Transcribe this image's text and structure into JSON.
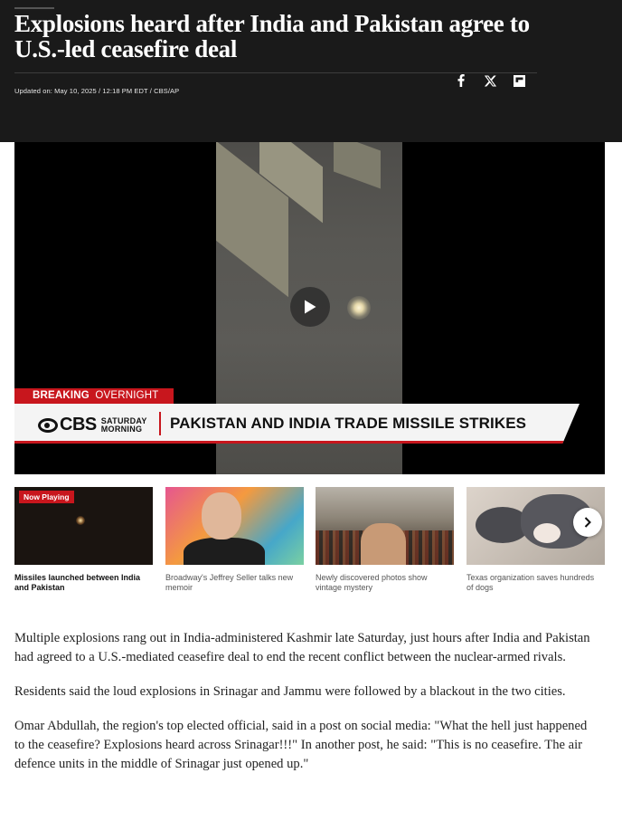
{
  "header": {
    "headline": "Explosions heard after India and Pakistan agree to U.S.-led ceasefire deal",
    "byline": "Updated on: May 10, 2025 / 12:18 PM EDT / CBS/AP",
    "social": [
      {
        "icon": "facebook-icon"
      },
      {
        "icon": "x-icon"
      },
      {
        "icon": "flipboard-icon"
      }
    ]
  },
  "video": {
    "breaking_label": "BREAKING",
    "breaking_sub": "OVERNIGHT",
    "network": "CBS",
    "network_sub_line1": "SATURDAY",
    "network_sub_line2": "MORNING",
    "chyron": "PAKISTAN AND INDIA TRADE MISSILE STRIKES"
  },
  "carousel": {
    "now_playing": "Now Playing",
    "items": [
      {
        "caption": "Missiles launched between India and Pakistan"
      },
      {
        "caption": "Broadway's Jeffrey Seller talks new memoir"
      },
      {
        "caption": "Newly discovered photos show vintage mystery"
      },
      {
        "caption": "Texas organization saves hundreds of dogs"
      }
    ]
  },
  "article": {
    "paragraphs": [
      "Multiple explosions rang out in India-administered Kashmir late Saturday, just hours after India and Pakistan had agreed to a U.S.-mediated ceasefire deal to end the recent conflict between the nuclear-armed rivals.",
      "Residents said the loud explosions in Srinagar and Jammu were followed by a blackout in the two cities.",
      "Omar Abdullah, the region's top elected official, said in a post on social media: \"What the hell just happened to the ceasefire? Explosions heard across Srinagar!!!\" In another post, he said: \"This is no ceasefire. The air defence units in the middle of Srinagar just opened up.\""
    ]
  },
  "colors": {
    "accent": "#c8161d",
    "header_bg": "#1a1a1a"
  }
}
